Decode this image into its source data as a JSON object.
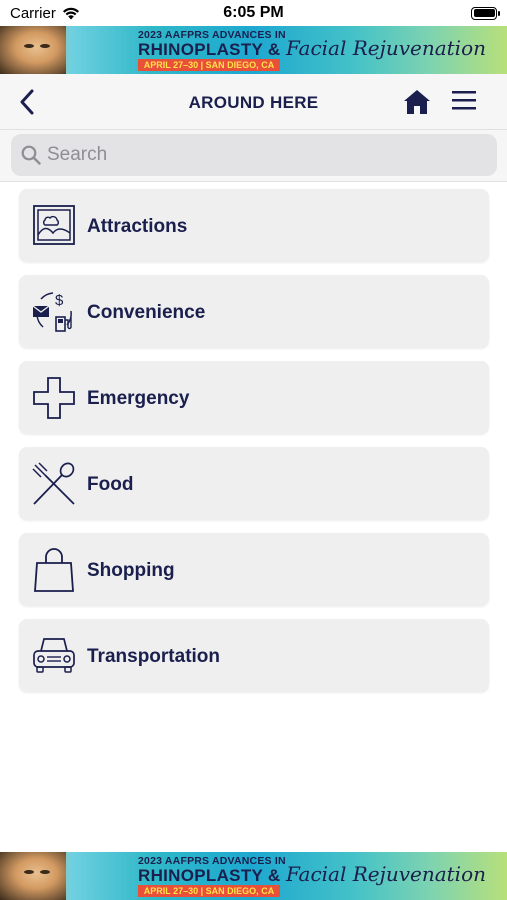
{
  "status_bar": {
    "carrier": "Carrier",
    "time": "6:05 PM"
  },
  "banner": {
    "line1": "2023 AAFPRS ADVANCES IN",
    "line2": "RHINOPLASTY &",
    "script": "Facial Rejuvenation",
    "dates": "APRIL 27–30 | SAN DIEGO, CA"
  },
  "nav": {
    "title": "AROUND HERE",
    "back_icon": "chevron-left-icon",
    "home_icon": "home-icon",
    "menu_icon": "hamburger-menu-icon"
  },
  "search": {
    "placeholder": "Search",
    "value": ""
  },
  "categories": [
    {
      "label": "Attractions",
      "icon": "landscape-picture-icon"
    },
    {
      "label": "Convenience",
      "icon": "mail-dollar-fuel-icon"
    },
    {
      "label": "Emergency",
      "icon": "medical-cross-icon"
    },
    {
      "label": "Food",
      "icon": "fork-spoon-icon"
    },
    {
      "label": "Shopping",
      "icon": "shopping-bag-icon"
    },
    {
      "label": "Transportation",
      "icon": "car-icon"
    }
  ],
  "colors": {
    "accent": "#1a1f4d",
    "card": "#efefef",
    "nav_bg": "#f6f6f7"
  }
}
